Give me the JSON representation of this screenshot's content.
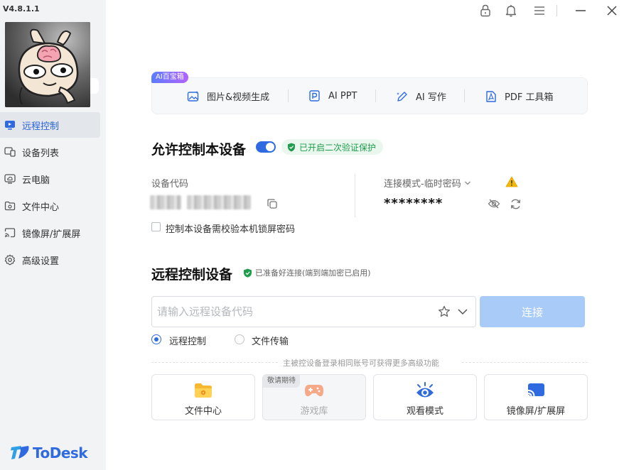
{
  "app": {
    "version": "V4.8.1.1",
    "brand": "ToDesk",
    "accent": "#2f6ae0"
  },
  "sidebar": {
    "items": [
      {
        "label": "远程控制",
        "icon": "monitor-icon",
        "active": true
      },
      {
        "label": "设备列表",
        "icon": "devices-icon",
        "active": false
      },
      {
        "label": "云电脑",
        "icon": "cloud-pc-icon",
        "active": false
      },
      {
        "label": "文件中心",
        "icon": "folder-icon",
        "active": false
      },
      {
        "label": "镜像屏/扩展屏",
        "icon": "cast-icon",
        "active": false
      },
      {
        "label": "高级设置",
        "icon": "gear-icon",
        "active": false
      }
    ]
  },
  "titlebar": {
    "icons": [
      "lock-icon",
      "bell-icon",
      "menu-icon",
      "minimize-icon",
      "close-icon"
    ]
  },
  "ai_toolbar": {
    "badge": "AI百宝箱",
    "items": [
      {
        "label": "图片&视频生成",
        "icon": "image-gen-icon"
      },
      {
        "label": "AI PPT",
        "icon": "ppt-icon"
      },
      {
        "label": "AI 写作",
        "icon": "pen-icon"
      },
      {
        "label": "PDF 工具箱",
        "icon": "pdf-icon"
      }
    ]
  },
  "allow_control": {
    "title": "允许控制本设备",
    "toggle_on": true,
    "badge": "已开启二次验证保护",
    "device_code_label": "设备代码",
    "mode_label": "连接模式-临时密码",
    "password_masked": "********",
    "lock_password_label": "控制本设备需校验本机锁屏密码",
    "lock_password_checked": false
  },
  "remote_control": {
    "title": "远程控制设备",
    "status": "已准备好连接(端到端加密已启用)",
    "input_placeholder": "请输入远程设备代码",
    "connect_label": "连接",
    "modes": [
      {
        "label": "远程控制",
        "selected": true
      },
      {
        "label": "文件传输",
        "selected": false
      }
    ],
    "hint": "主被控设备登录相同账号可获得更多高级功能",
    "cards": [
      {
        "label": "文件中心",
        "icon": "folder-icon",
        "disabled": false
      },
      {
        "label": "游戏库",
        "icon": "gamepad-icon",
        "disabled": true,
        "badge": "敬请期待"
      },
      {
        "label": "观看模式",
        "icon": "eye-icon",
        "disabled": false
      },
      {
        "label": "镜像屏/扩展屏",
        "icon": "cast-icon",
        "disabled": false
      }
    ]
  }
}
